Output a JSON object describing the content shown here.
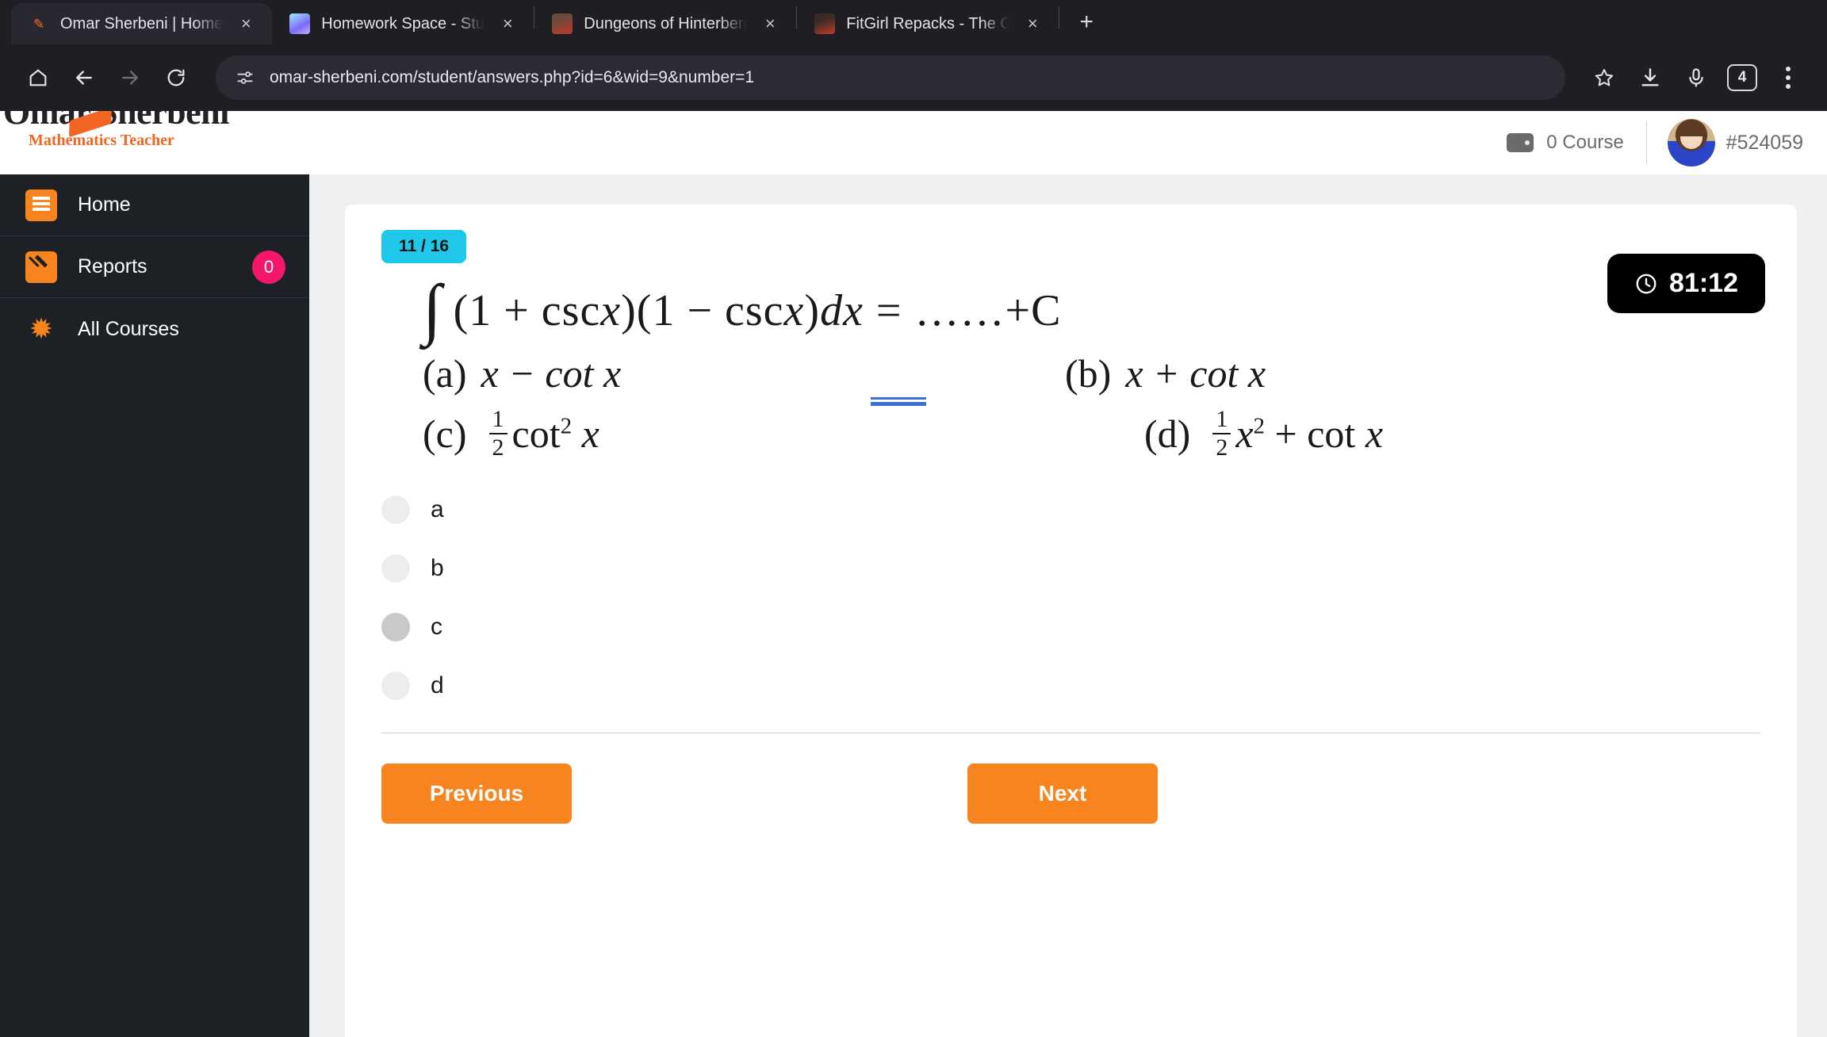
{
  "browser": {
    "tabs": [
      {
        "title": "Omar Sherbeni | Home",
        "favicon": "pencil-favicon",
        "active": true
      },
      {
        "title": "Homework Space - StudyX",
        "favicon": "studyx-favicon",
        "active": false
      },
      {
        "title": "Dungeons of Hinterberg - v",
        "favicon": "dungeon-favicon",
        "active": false
      },
      {
        "title": "FitGirl Repacks - The ONLY",
        "favicon": "fitgirl-favicon",
        "active": false
      }
    ],
    "new_tab_label": "+",
    "close_label": "×",
    "toolbar": {
      "home_icon": "home-icon",
      "back_icon": "back-arrow-icon",
      "forward_icon": "forward-arrow-icon",
      "reload_icon": "reload-icon",
      "site_info_icon": "site-info-icon",
      "url": "omar-sherbeni.com/student/answers.php?id=6&wid=9&number=1",
      "bookmark_icon": "star-icon",
      "download_icon": "download-icon",
      "mic_icon": "microphone-icon",
      "profile_label": "4",
      "menu_icon": "three-dot-menu-icon"
    }
  },
  "site_header": {
    "brand_name": "Omar Sherbeni",
    "brand_tagline": "Mathematics Teacher",
    "course_count": "0 Course",
    "user_id": "#524059"
  },
  "sidebar": {
    "items": [
      {
        "label": "Home",
        "icon": "book-icon",
        "badge": null
      },
      {
        "label": "Reports",
        "icon": "pencil-icon",
        "badge": "0"
      },
      {
        "label": "All Courses",
        "icon": "starburst-icon",
        "badge": null
      }
    ]
  },
  "quiz": {
    "progress": "11 / 16",
    "timer": "81:12",
    "question": {
      "integral_symbol": "∫",
      "expression_parts": {
        "open1": "(1 + csc ",
        "var1": "x",
        "close1": ")(1 − csc ",
        "var2": "x",
        "close2": ")",
        "dx": "dx",
        "equals": "=",
        "dots": "……+C"
      },
      "choices": [
        {
          "tag": "(a)",
          "text": "x − cot x"
        },
        {
          "tag": "(b)",
          "text": "x + cot x",
          "marked": true
        },
        {
          "tag": "(c)",
          "text": "½ cot² x"
        },
        {
          "tag": "(d)",
          "text": "½ x² + cot x"
        }
      ],
      "choice_c_fraction": {
        "num": "1",
        "den": "2"
      },
      "choice_d_fraction": {
        "num": "1",
        "den": "2"
      }
    },
    "answers": [
      {
        "value": "a",
        "state": "normal"
      },
      {
        "value": "b",
        "state": "normal"
      },
      {
        "value": "c",
        "state": "hover"
      },
      {
        "value": "d",
        "state": "normal"
      }
    ],
    "previous_label": "Previous",
    "next_label": "Next"
  },
  "colors": {
    "accent_orange": "#f7841f",
    "badge_pink": "#f5176b",
    "progress_cyan": "#1fc8e8",
    "sidebar_dark": "#1d2125",
    "chrome_dark": "#1f1f23",
    "mark_blue": "#3f6fd8"
  }
}
